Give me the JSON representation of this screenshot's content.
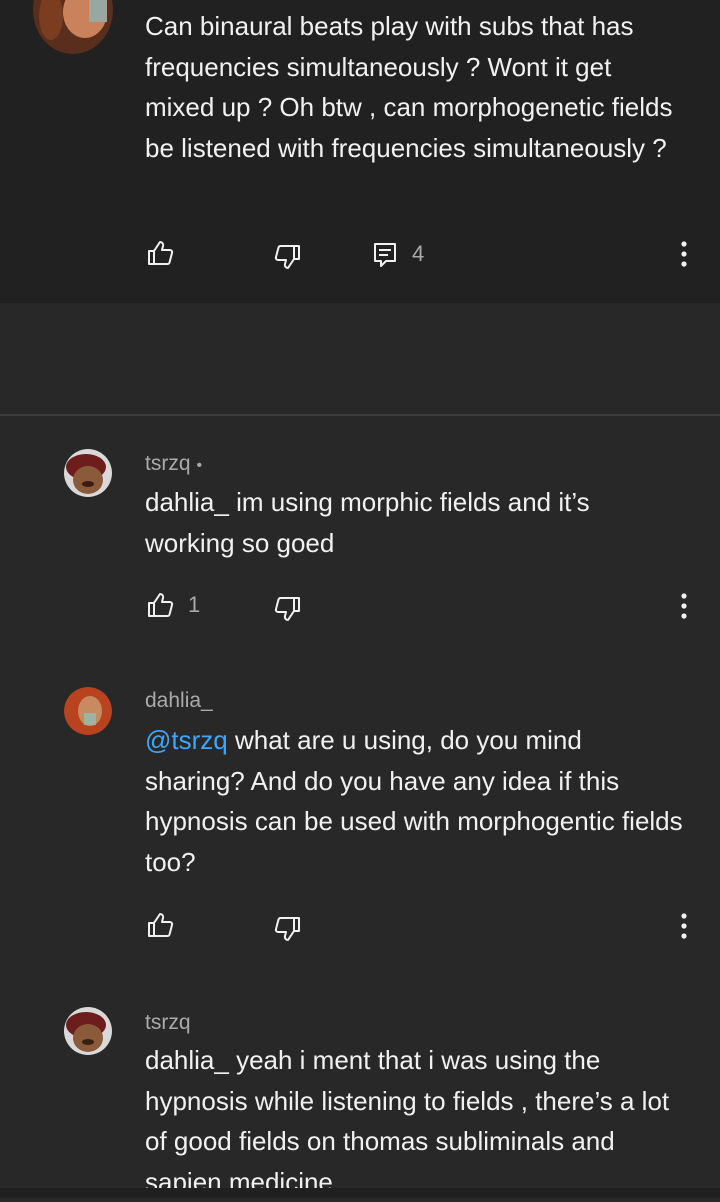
{
  "comments": [
    {
      "author": "",
      "text": "Can binaural beats play with subs that has frequencies simultaneously  ? Wont it get mixed up ? Oh btw , can morphogenetic fields be listened with frequencies simultaneously ?",
      "likes": "",
      "replies": "4"
    },
    {
      "author": "tsrzq",
      "text": "dahlia_ im using morphic fields and it’s working so goed",
      "likes": "1"
    },
    {
      "author": "dahlia_",
      "mention": "@tsrzq",
      "text": " what are u using, do you mind sharing? And do you have any idea if this hypnosis can be used with morphogentic fields too?",
      "likes": ""
    },
    {
      "author": "tsrzq",
      "text": "dahlia_ yeah i ment that i was using the hypnosis while listening to fields , there’s a lot of good fields on thomas subliminals and sapien medicine"
    }
  ],
  "colors": {
    "background": "#282828",
    "top_block": "#212121",
    "text": "#f1f1f1",
    "secondary_text": "#aaaaaa",
    "mention": "#3ea6ff"
  },
  "icons": [
    "thumbs-up-icon",
    "thumbs-down-icon",
    "reply-icon",
    "more-vert-icon"
  ]
}
